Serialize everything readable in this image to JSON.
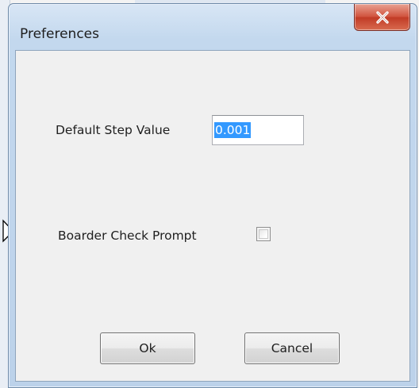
{
  "dialog": {
    "title": "Preferences",
    "close_icon": "close-icon"
  },
  "fields": {
    "step_label": "Default Step Value",
    "step_value": "0.001",
    "border_label": "Boarder Check Prompt",
    "border_checked": false
  },
  "buttons": {
    "ok_label": "Ok",
    "cancel_label": "Cancel"
  },
  "colors": {
    "selection": "#3399ff",
    "close_button": "#c13b26",
    "client_background": "#f0f0f0"
  }
}
